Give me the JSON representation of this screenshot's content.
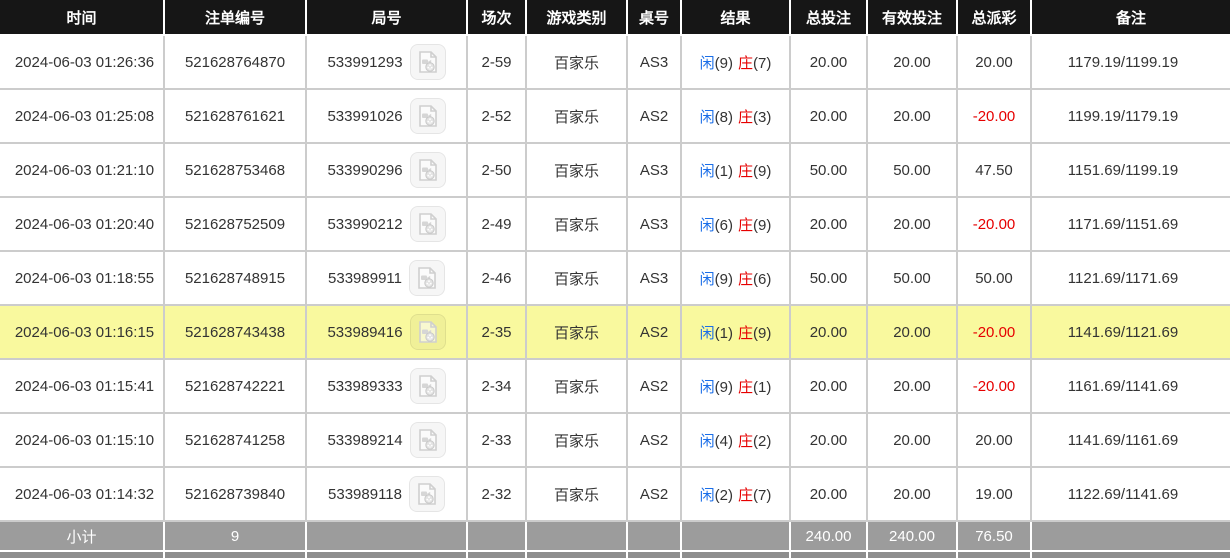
{
  "table": {
    "columns": [
      {
        "key": "time",
        "label": "时间"
      },
      {
        "key": "bet_no",
        "label": "注单编号"
      },
      {
        "key": "game_no",
        "label": "局号"
      },
      {
        "key": "session",
        "label": "场次"
      },
      {
        "key": "game_type",
        "label": "游戏类别"
      },
      {
        "key": "table_no",
        "label": "桌号"
      },
      {
        "key": "result",
        "label": "结果"
      },
      {
        "key": "total_bet",
        "label": "总投注"
      },
      {
        "key": "valid_bet",
        "label": "有效投注"
      },
      {
        "key": "payout",
        "label": "总派彩"
      },
      {
        "key": "remark",
        "label": "备注"
      }
    ],
    "result_labels": {
      "player": "闲",
      "banker": "庄"
    },
    "rows": [
      {
        "time": "2024-06-03 01:26:36",
        "bet_no": "521628764870",
        "game_no": "533991293",
        "session": "2-59",
        "game_type": "百家乐",
        "table_no": "AS3",
        "player_pts": "9",
        "banker_pts": "7",
        "total_bet": "20.00",
        "valid_bet": "20.00",
        "payout": "20.00",
        "remark": "1179.19/1199.19",
        "highlighted": false
      },
      {
        "time": "2024-06-03 01:25:08",
        "bet_no": "521628761621",
        "game_no": "533991026",
        "session": "2-52",
        "game_type": "百家乐",
        "table_no": "AS2",
        "player_pts": "8",
        "banker_pts": "3",
        "total_bet": "20.00",
        "valid_bet": "20.00",
        "payout": "-20.00",
        "remark": "1199.19/1179.19",
        "highlighted": false
      },
      {
        "time": "2024-06-03 01:21:10",
        "bet_no": "521628753468",
        "game_no": "533990296",
        "session": "2-50",
        "game_type": "百家乐",
        "table_no": "AS3",
        "player_pts": "1",
        "banker_pts": "9",
        "total_bet": "50.00",
        "valid_bet": "50.00",
        "payout": "47.50",
        "remark": "1151.69/1199.19",
        "highlighted": false
      },
      {
        "time": "2024-06-03 01:20:40",
        "bet_no": "521628752509",
        "game_no": "533990212",
        "session": "2-49",
        "game_type": "百家乐",
        "table_no": "AS3",
        "player_pts": "6",
        "banker_pts": "9",
        "total_bet": "20.00",
        "valid_bet": "20.00",
        "payout": "-20.00",
        "remark": "1171.69/1151.69",
        "highlighted": false
      },
      {
        "time": "2024-06-03 01:18:55",
        "bet_no": "521628748915",
        "game_no": "533989911",
        "session": "2-46",
        "game_type": "百家乐",
        "table_no": "AS3",
        "player_pts": "9",
        "banker_pts": "6",
        "total_bet": "50.00",
        "valid_bet": "50.00",
        "payout": "50.00",
        "remark": "1121.69/1171.69",
        "highlighted": false
      },
      {
        "time": "2024-06-03 01:16:15",
        "bet_no": "521628743438",
        "game_no": "533989416",
        "session": "2-35",
        "game_type": "百家乐",
        "table_no": "AS2",
        "player_pts": "1",
        "banker_pts": "9",
        "total_bet": "20.00",
        "valid_bet": "20.00",
        "payout": "-20.00",
        "remark": "1141.69/1121.69",
        "highlighted": true
      },
      {
        "time": "2024-06-03 01:15:41",
        "bet_no": "521628742221",
        "game_no": "533989333",
        "session": "2-34",
        "game_type": "百家乐",
        "table_no": "AS2",
        "player_pts": "9",
        "banker_pts": "1",
        "total_bet": "20.00",
        "valid_bet": "20.00",
        "payout": "-20.00",
        "remark": "1161.69/1141.69",
        "highlighted": false
      },
      {
        "time": "2024-06-03 01:15:10",
        "bet_no": "521628741258",
        "game_no": "533989214",
        "session": "2-33",
        "game_type": "百家乐",
        "table_no": "AS2",
        "player_pts": "4",
        "banker_pts": "2",
        "total_bet": "20.00",
        "valid_bet": "20.00",
        "payout": "20.00",
        "remark": "1141.69/1161.69",
        "highlighted": false
      },
      {
        "time": "2024-06-03 01:14:32",
        "bet_no": "521628739840",
        "game_no": "533989118",
        "session": "2-32",
        "game_type": "百家乐",
        "table_no": "AS2",
        "player_pts": "2",
        "banker_pts": "7",
        "total_bet": "20.00",
        "valid_bet": "20.00",
        "payout": "19.00",
        "remark": "1122.69/1141.69",
        "highlighted": false
      }
    ],
    "subtotal": {
      "label": "小计",
      "bet_count": "9",
      "total_bet": "240.00",
      "valid_bet": "240.00",
      "payout": "76.50"
    }
  },
  "icons": {
    "video": "video-file-icon"
  },
  "colors": {
    "header_bg": "#161616",
    "border": "#cccccc",
    "highlight": "#f9f99e",
    "bet_blue": "#1a6ee8",
    "banker_red": "#e60000",
    "negative_red": "#e60000",
    "subtotal_bg": "#9c9c9c",
    "next_strip_bg": "#8e8e8e"
  }
}
